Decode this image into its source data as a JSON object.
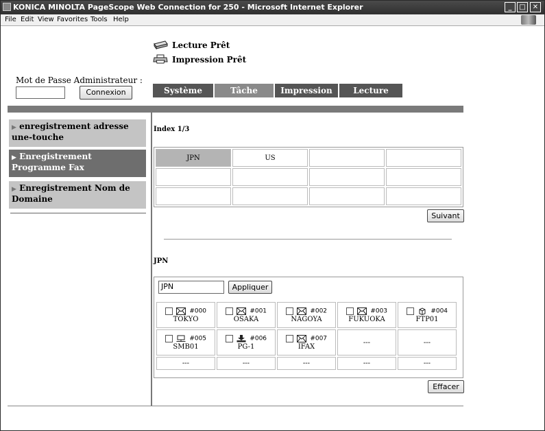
{
  "window": {
    "title": "KONICA MINOLTA PageScope Web Connection for 250 - Microsoft Internet Explorer",
    "controls": {
      "minimize": "_",
      "maximize": "□",
      "close": "✕"
    }
  },
  "menu": [
    "File",
    "Edit",
    "View",
    "Favorites",
    "Tools",
    "Help"
  ],
  "status": {
    "scan": "Lecture Prêt",
    "print": "Impression Prêt"
  },
  "admin": {
    "label": "Mot de Passe Administrateur :",
    "password_value": "",
    "login_button": "Connexion"
  },
  "tabs": [
    {
      "label": "Système",
      "color": "#555555"
    },
    {
      "label": "Tâche",
      "color": "#8a8a8a"
    },
    {
      "label": "Impression",
      "color": "#555555"
    },
    {
      "label": "Lecture",
      "color": "#555555"
    }
  ],
  "sidebar": [
    {
      "label": "enregistrement adresse une-touche",
      "bg": "#c4c4c4",
      "fg": "#000000"
    },
    {
      "label": "Enregistrement Programme Fax",
      "bg": "#6e6e6e",
      "fg": "#ffffff"
    },
    {
      "label": "Enregistrement Nom de Domaine",
      "bg": "#c4c4c4",
      "fg": "#000000"
    }
  ],
  "index": {
    "title": "Index 1/3",
    "rows": [
      [
        "JPN",
        "US",
        "",
        ""
      ],
      [
        "",
        "",
        "",
        ""
      ],
      [
        "",
        "",
        "",
        ""
      ]
    ],
    "next_button": "Suivant"
  },
  "group": {
    "title": "JPN",
    "name_value": "JPN",
    "apply_button": "Appliquer",
    "destinations": [
      [
        {
          "num": "#000",
          "name": "TOKYO",
          "icon": "mail-icon"
        },
        {
          "num": "#001",
          "name": "OSAKA",
          "icon": "mail-icon"
        },
        {
          "num": "#002",
          "name": "NAGOYA",
          "icon": "mail-icon"
        },
        {
          "num": "#003",
          "name": "FUKUOKA",
          "icon": "mail-icon"
        },
        {
          "num": "#004",
          "name": "FTP01",
          "icon": "ftp-icon"
        }
      ],
      [
        {
          "num": "#005",
          "name": "SMB01",
          "icon": "smb-icon"
        },
        {
          "num": "#006",
          "name": "PG-1",
          "icon": "program-icon"
        },
        {
          "num": "#007",
          "name": "IFAX",
          "icon": "mail-icon"
        },
        {
          "empty": "---"
        },
        {
          "empty": "---"
        }
      ],
      [
        {
          "empty": "---"
        },
        {
          "empty": "---"
        },
        {
          "empty": "---"
        },
        {
          "empty": "---"
        },
        {
          "empty": "---"
        }
      ]
    ],
    "clear_button": "Effacer"
  }
}
